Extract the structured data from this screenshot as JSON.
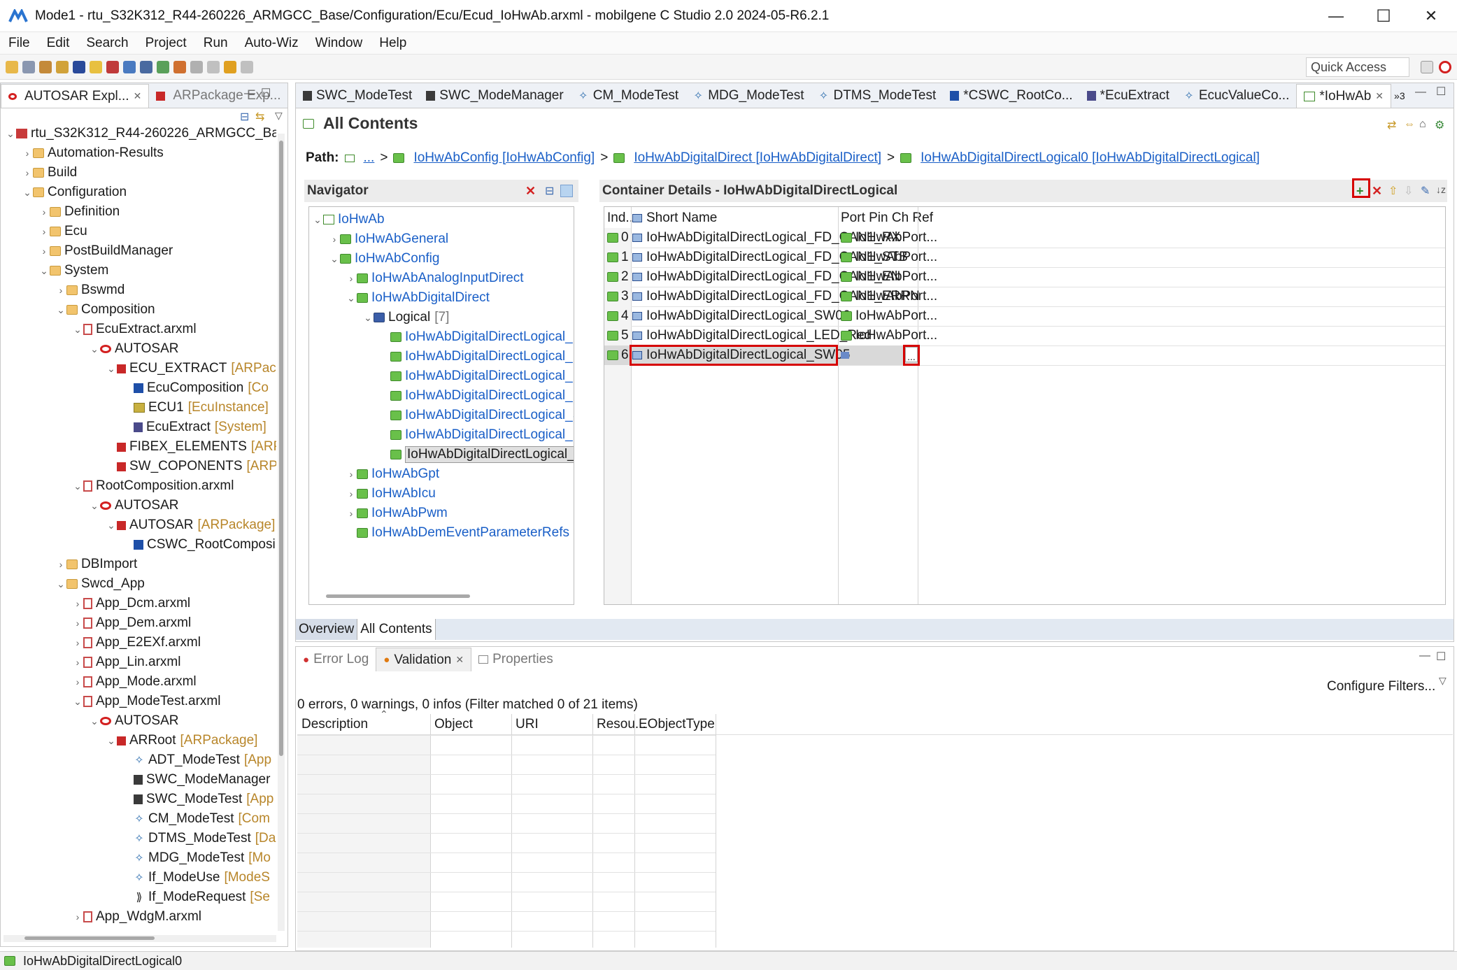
{
  "window": {
    "title": "Mode1 - rtu_S32K312_R44-260226_ARMGCC_Base/Configuration/Ecu/Ecud_IoHwAb.arxml - mobilgene C Studio 2.0 2024-05-R6.2.1",
    "minimize": "—",
    "maximize": "☐",
    "close": "✕"
  },
  "menu": [
    "File",
    "Edit",
    "Search",
    "Project",
    "Run",
    "Auto-Wiz",
    "Window",
    "Help"
  ],
  "quick_access": "Quick Access",
  "left_panel": {
    "tabs": [
      "AUTOSAR Expl...",
      "ARPackage Exp..."
    ],
    "tree": [
      {
        "label": "rtu_S32K312_R44-260226_ARMGCC_Base",
        "tag": "",
        "icon": "project",
        "depth": 0,
        "tw": "v"
      },
      {
        "label": "Automation-Results",
        "tag": "",
        "icon": "folder",
        "depth": 1,
        "tw": ">"
      },
      {
        "label": "Build",
        "tag": "",
        "icon": "folder",
        "depth": 1,
        "tw": ">"
      },
      {
        "label": "Configuration",
        "tag": "",
        "icon": "folder",
        "depth": 1,
        "tw": "v"
      },
      {
        "label": "Definition",
        "tag": "",
        "icon": "folder",
        "depth": 2,
        "tw": ">"
      },
      {
        "label": "Ecu",
        "tag": "",
        "icon": "folder",
        "depth": 2,
        "tw": ">"
      },
      {
        "label": "PostBuildManager",
        "tag": "",
        "icon": "folder",
        "depth": 2,
        "tw": ">"
      },
      {
        "label": "System",
        "tag": "",
        "icon": "folder",
        "depth": 2,
        "tw": "v"
      },
      {
        "label": "Bswmd",
        "tag": "",
        "icon": "folder",
        "depth": 3,
        "tw": ">"
      },
      {
        "label": "Composition",
        "tag": "",
        "icon": "folder",
        "depth": 3,
        "tw": "v"
      },
      {
        "label": "EcuExtract.arxml",
        "tag": "",
        "icon": "file",
        "depth": 4,
        "tw": "v"
      },
      {
        "label": "AUTOSAR",
        "tag": "",
        "icon": "autosar",
        "depth": 5,
        "tw": "v"
      },
      {
        "label": "ECU_EXTRACT",
        "tag": "[ARPacka",
        "icon": "pkg",
        "depth": 6,
        "tw": "v"
      },
      {
        "label": "EcuComposition",
        "tag": "[Co",
        "icon": "comp",
        "depth": 7,
        "tw": ""
      },
      {
        "label": "ECU1",
        "tag": "[EcuInstance]",
        "icon": "ecu",
        "depth": 7,
        "tw": ""
      },
      {
        "label": "EcuExtract",
        "tag": "[System]",
        "icon": "sys",
        "depth": 7,
        "tw": ""
      },
      {
        "label": "FIBEX_ELEMENTS",
        "tag": "[ARPa",
        "icon": "pkg",
        "depth": 6,
        "tw": ""
      },
      {
        "label": "SW_COPONENTS",
        "tag": "[ARPa",
        "icon": "pkg",
        "depth": 6,
        "tw": ""
      },
      {
        "label": "RootComposition.arxml",
        "tag": "",
        "icon": "file",
        "depth": 4,
        "tw": "v"
      },
      {
        "label": "AUTOSAR",
        "tag": "",
        "icon": "autosar",
        "depth": 5,
        "tw": "v"
      },
      {
        "label": "AUTOSAR",
        "tag": "[ARPackage]",
        "icon": "pkg",
        "depth": 6,
        "tw": "v"
      },
      {
        "label": "CSWC_RootComposi",
        "tag": "",
        "icon": "comp",
        "depth": 7,
        "tw": ""
      },
      {
        "label": "DBImport",
        "tag": "",
        "icon": "folder",
        "depth": 3,
        "tw": ">"
      },
      {
        "label": "Swcd_App",
        "tag": "",
        "icon": "folder",
        "depth": 3,
        "tw": "v"
      },
      {
        "label": "App_Dcm.arxml",
        "tag": "",
        "icon": "file",
        "depth": 4,
        "tw": ">"
      },
      {
        "label": "App_Dem.arxml",
        "tag": "",
        "icon": "file",
        "depth": 4,
        "tw": ">"
      },
      {
        "label": "App_E2EXf.arxml",
        "tag": "",
        "icon": "file",
        "depth": 4,
        "tw": ">"
      },
      {
        "label": "App_Lin.arxml",
        "tag": "",
        "icon": "file",
        "depth": 4,
        "tw": ">"
      },
      {
        "label": "App_Mode.arxml",
        "tag": "",
        "icon": "file",
        "depth": 4,
        "tw": ">"
      },
      {
        "label": "App_ModeTest.arxml",
        "tag": "",
        "icon": "file",
        "depth": 4,
        "tw": "v"
      },
      {
        "label": "AUTOSAR",
        "tag": "",
        "icon": "autosar",
        "depth": 5,
        "tw": "v"
      },
      {
        "label": "ARRoot",
        "tag": "[ARPackage]",
        "icon": "pkg",
        "depth": 6,
        "tw": "v"
      },
      {
        "label": "ADT_ModeTest",
        "tag": "[App",
        "icon": "diam",
        "depth": 7,
        "tw": ""
      },
      {
        "label": "SWC_ModeManager",
        "tag": "",
        "icon": "swc",
        "depth": 7,
        "tw": ""
      },
      {
        "label": "SWC_ModeTest",
        "tag": "[App",
        "icon": "swc",
        "depth": 7,
        "tw": ""
      },
      {
        "label": "CM_ModeTest",
        "tag": "[Com",
        "icon": "diam",
        "depth": 7,
        "tw": ""
      },
      {
        "label": "DTMS_ModeTest",
        "tag": "[Da",
        "icon": "diam",
        "depth": 7,
        "tw": ""
      },
      {
        "label": "MDG_ModeTest",
        "tag": "[Mo",
        "icon": "diam",
        "depth": 7,
        "tw": ""
      },
      {
        "label": "If_ModeUse",
        "tag": "[ModeS",
        "icon": "diam",
        "depth": 7,
        "tw": ""
      },
      {
        "label": "If_ModeRequest",
        "tag": "[Se",
        "icon": "req",
        "depth": 7,
        "tw": ""
      },
      {
        "label": "App_WdgM.arxml",
        "tag": "",
        "icon": "file",
        "depth": 4,
        "tw": ">"
      }
    ]
  },
  "editor_tabs": [
    "SWC_ModeTest",
    "SWC_ModeManager",
    "CM_ModeTest",
    "MDG_ModeTest",
    "DTMS_ModeTest",
    "*CSWC_RootCo...",
    "*EcuExtract",
    "EcucValueCo...",
    "*IoHwAb"
  ],
  "overflow_count": "»3",
  "editor": {
    "heading": "All Contents",
    "path_label": "Path:",
    "path_items": [
      "...",
      "IoHwAbConfig [IoHwAbConfig]",
      "IoHwAbDigitalDirect [IoHwAbDigitalDirect]",
      "IoHwAbDigitalDirectLogical0 [IoHwAbDigitalDirectLogical]"
    ],
    "navigator_title": "Navigator",
    "navigator_tree": [
      {
        "label": "IoHwAb",
        "depth": 0,
        "tw": "v",
        "icon": "white"
      },
      {
        "label": "IoHwAbGeneral",
        "depth": 1,
        "tw": ">",
        "icon": "green"
      },
      {
        "label": "IoHwAbConfig",
        "depth": 1,
        "tw": "v",
        "icon": "green"
      },
      {
        "label": "IoHwAbAnalogInputDirect",
        "depth": 2,
        "tw": ">",
        "icon": "green"
      },
      {
        "label": "IoHwAbDigitalDirect",
        "depth": 2,
        "tw": "v",
        "icon": "green"
      },
      {
        "label": "Logical",
        "count": "[7]",
        "depth": 3,
        "tw": "v",
        "icon": "blue"
      },
      {
        "label": "IoHwAbDigitalDirectLogical_F",
        "depth": 4,
        "tw": "",
        "icon": "green"
      },
      {
        "label": "IoHwAbDigitalDirectLogical_F",
        "depth": 4,
        "tw": "",
        "icon": "green"
      },
      {
        "label": "IoHwAbDigitalDirectLogical_F",
        "depth": 4,
        "tw": "",
        "icon": "green"
      },
      {
        "label": "IoHwAbDigitalDirectLogical_F",
        "depth": 4,
        "tw": "",
        "icon": "green"
      },
      {
        "label": "IoHwAbDigitalDirectLogical_S",
        "depth": 4,
        "tw": "",
        "icon": "green"
      },
      {
        "label": "IoHwAbDigitalDirectLogical_L",
        "depth": 4,
        "tw": "",
        "icon": "green"
      },
      {
        "label": "IoHwAbDigitalDirectLogical_S",
        "depth": 4,
        "tw": "",
        "icon": "green",
        "selected": true
      },
      {
        "label": "IoHwAbGpt",
        "depth": 2,
        "tw": ">",
        "icon": "green"
      },
      {
        "label": "IoHwAbIcu",
        "depth": 2,
        "tw": ">",
        "icon": "green"
      },
      {
        "label": "IoHwAbPwm",
        "depth": 2,
        "tw": ">",
        "icon": "green"
      },
      {
        "label": "IoHwAbDemEventParameterRefs",
        "depth": 2,
        "tw": "",
        "icon": "green"
      }
    ],
    "details_title": "Container Details - IoHwAbDigitalDirectLogical",
    "columns": [
      "Ind...",
      "Short Name",
      "Port Pin Ch Ref"
    ],
    "rows": [
      {
        "index": "0",
        "name": "IoHwAbDigitalDirectLogical_FD_CAN1_RX",
        "ref": "IoHwAbPort..."
      },
      {
        "index": "1",
        "name": "IoHwAbDigitalDirectLogical_FD_CAN1_STB",
        "ref": "IoHwAbPort..."
      },
      {
        "index": "2",
        "name": "IoHwAbDigitalDirectLogical_FD_CAN1_EN",
        "ref": "IoHwAbPort..."
      },
      {
        "index": "3",
        "name": "IoHwAbDigitalDirectLogical_FD_CAN1_ERRN",
        "ref": "IoHwAbPort..."
      },
      {
        "index": "4",
        "name": "IoHwAbDigitalDirectLogical_SW06",
        "ref": "IoHwAbPort..."
      },
      {
        "index": "5",
        "name": "IoHwAbDigitalDirectLogical_LED_Red",
        "ref": "IoHwAbPort..."
      },
      {
        "index": "6",
        "name": "IoHwAbDigitalDirectLogical_SW05",
        "ref": ""
      }
    ],
    "browse_button": "...",
    "bottom_tabs": [
      "Overview",
      "All Contents"
    ]
  },
  "bottom_panel": {
    "tabs": [
      "Error Log",
      "Validation",
      "Properties"
    ],
    "summary": "0 errors, 0 warnings, 0 infos (Filter matched 0 of 21 items)",
    "configure_filters": "Configure Filters...",
    "columns": [
      "Description",
      "Object",
      "URI",
      "Resou...",
      "EObjectType"
    ]
  },
  "status_bar": "IoHwAbDigitalDirectLogical0",
  "colors": {
    "accent_red": "#d60000",
    "link": "#1a5fc7",
    "tab_bg": "#eef1f6"
  }
}
